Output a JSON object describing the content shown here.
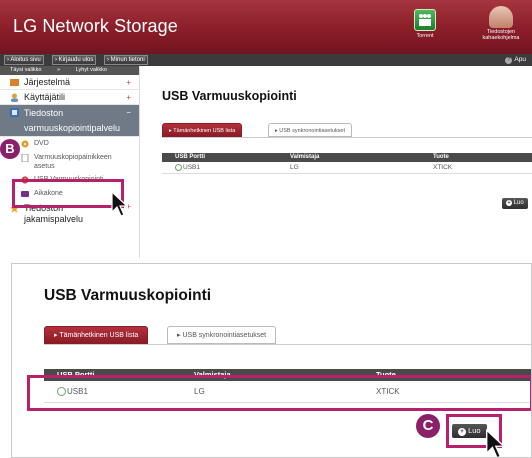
{
  "app": {
    "title": "LG Network Storage",
    "torrent_label": "Torrent",
    "help_label_line1": "Tiedostojen",
    "help_label_line2": "kahaekohjelma"
  },
  "nav": {
    "items": [
      "Aloitus sivu",
      "Kirjaudu ulos",
      "Minun tietoni"
    ],
    "help": "Apu"
  },
  "sidebar": {
    "toggle_full": "Täysi valikko",
    "toggle_short": "Lyhyt valikko",
    "categories": {
      "system": "Järjestelmä",
      "user": "Käyttäjätili",
      "backup_line1": "Tiedoston",
      "backup_line2": "varmuuskopiointipalvelu",
      "sharing_line1": "Tiedoston",
      "sharing_line2": "jakamispalvelu"
    },
    "subitems": {
      "dvd": "DVD",
      "backup_notice_line1": "Varmuuskopiopainikkeen",
      "backup_notice_line2": "asetus",
      "usb_backup": "USB Varmuuskopiointi",
      "schedule": "Aikakone"
    }
  },
  "page": {
    "title": "USB Varmuuskopiointi",
    "tab_active": "Tämänhetkinen USB lista",
    "tab_inactive": "USB synkronointiasetukset",
    "create_label": "Luo"
  },
  "table": {
    "columns": [
      "USB Portti",
      "Valmistaja",
      "Tuote"
    ],
    "rows": [
      {
        "port": "USB1",
        "maker": "LG",
        "product": "XTICK"
      }
    ]
  },
  "markers": {
    "b": "B",
    "c": "C"
  },
  "colors": {
    "header_red": "#8d1f2a",
    "tab_red": "#a32a35",
    "highlight_magenta": "#b8206c",
    "marker_purple": "#8a1f6a",
    "sidebar_active": "#6f7a86",
    "table_header": "#4a4a4a"
  }
}
